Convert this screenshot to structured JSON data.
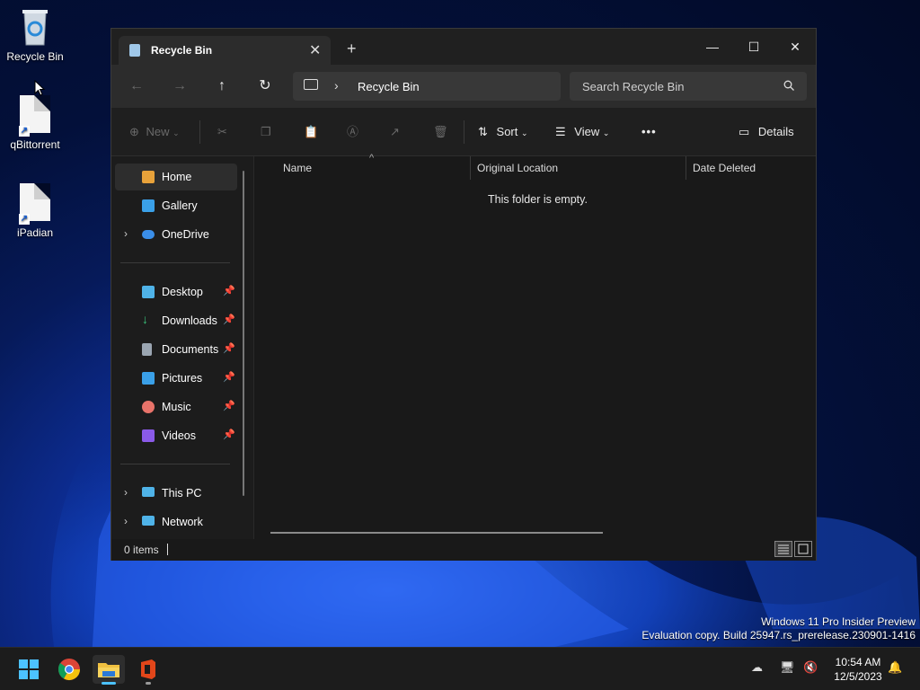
{
  "desktop": {
    "icons": [
      {
        "label": "Recycle Bin",
        "icon": "recycle-bin-icon"
      },
      {
        "label": "qBittorrent",
        "icon": "file-shortcut-icon"
      },
      {
        "label": "iPadian",
        "icon": "file-shortcut-icon"
      }
    ]
  },
  "window": {
    "tab_title": "Recycle Bin",
    "tab_close": "✕",
    "new_tab": "+",
    "controls": {
      "minimize": "—",
      "maximize": "☐",
      "close": "✕"
    },
    "nav": {
      "back": "←",
      "forward": "→",
      "up": "↑",
      "refresh": "↻"
    },
    "address": {
      "separator": "›",
      "crumb": "Recycle Bin"
    },
    "search": {
      "placeholder": "Search Recycle Bin"
    },
    "toolbar": {
      "new_label": "New",
      "sort_label": "Sort",
      "view_label": "View",
      "more_label": "•••",
      "details_label": "Details"
    },
    "sidebar": {
      "items": [
        {
          "label": "Home",
          "icon": "home-icon",
          "color": "#e8a23a"
        },
        {
          "label": "Gallery",
          "icon": "gallery-icon",
          "color": "#3aa0e8"
        },
        {
          "label": "OneDrive",
          "icon": "onedrive-icon",
          "color": "#3a8ee8"
        },
        {
          "label": "Desktop",
          "icon": "desktop-icon",
          "color": "#4fb3e8"
        },
        {
          "label": "Downloads",
          "icon": "downloads-icon",
          "color": "#3ac27a"
        },
        {
          "label": "Documents",
          "icon": "documents-icon",
          "color": "#9aa5b1"
        },
        {
          "label": "Pictures",
          "icon": "pictures-icon",
          "color": "#3aa0e8"
        },
        {
          "label": "Music",
          "icon": "music-icon",
          "color": "#e8736a"
        },
        {
          "label": "Videos",
          "icon": "videos-icon",
          "color": "#8a5ae8"
        },
        {
          "label": "This PC",
          "icon": "this-pc-icon",
          "color": "#4fb3e8"
        },
        {
          "label": "Network",
          "icon": "network-icon",
          "color": "#4fb3e8"
        }
      ],
      "pin_glyph": "📌",
      "expand_glyph": "›"
    },
    "columns": [
      "Name",
      "Original Location",
      "Date Deleted"
    ],
    "sort_indicator": "^",
    "empty_message": "This folder is empty.",
    "status": {
      "count": "0 items"
    }
  },
  "watermark": {
    "line1": "Windows 11 Pro Insider Preview",
    "line2": "Evaluation copy. Build 25947.rs_prerelease.230901-1416"
  },
  "taskbar": {
    "time": "10:54 AM",
    "date": "12/5/2023"
  }
}
